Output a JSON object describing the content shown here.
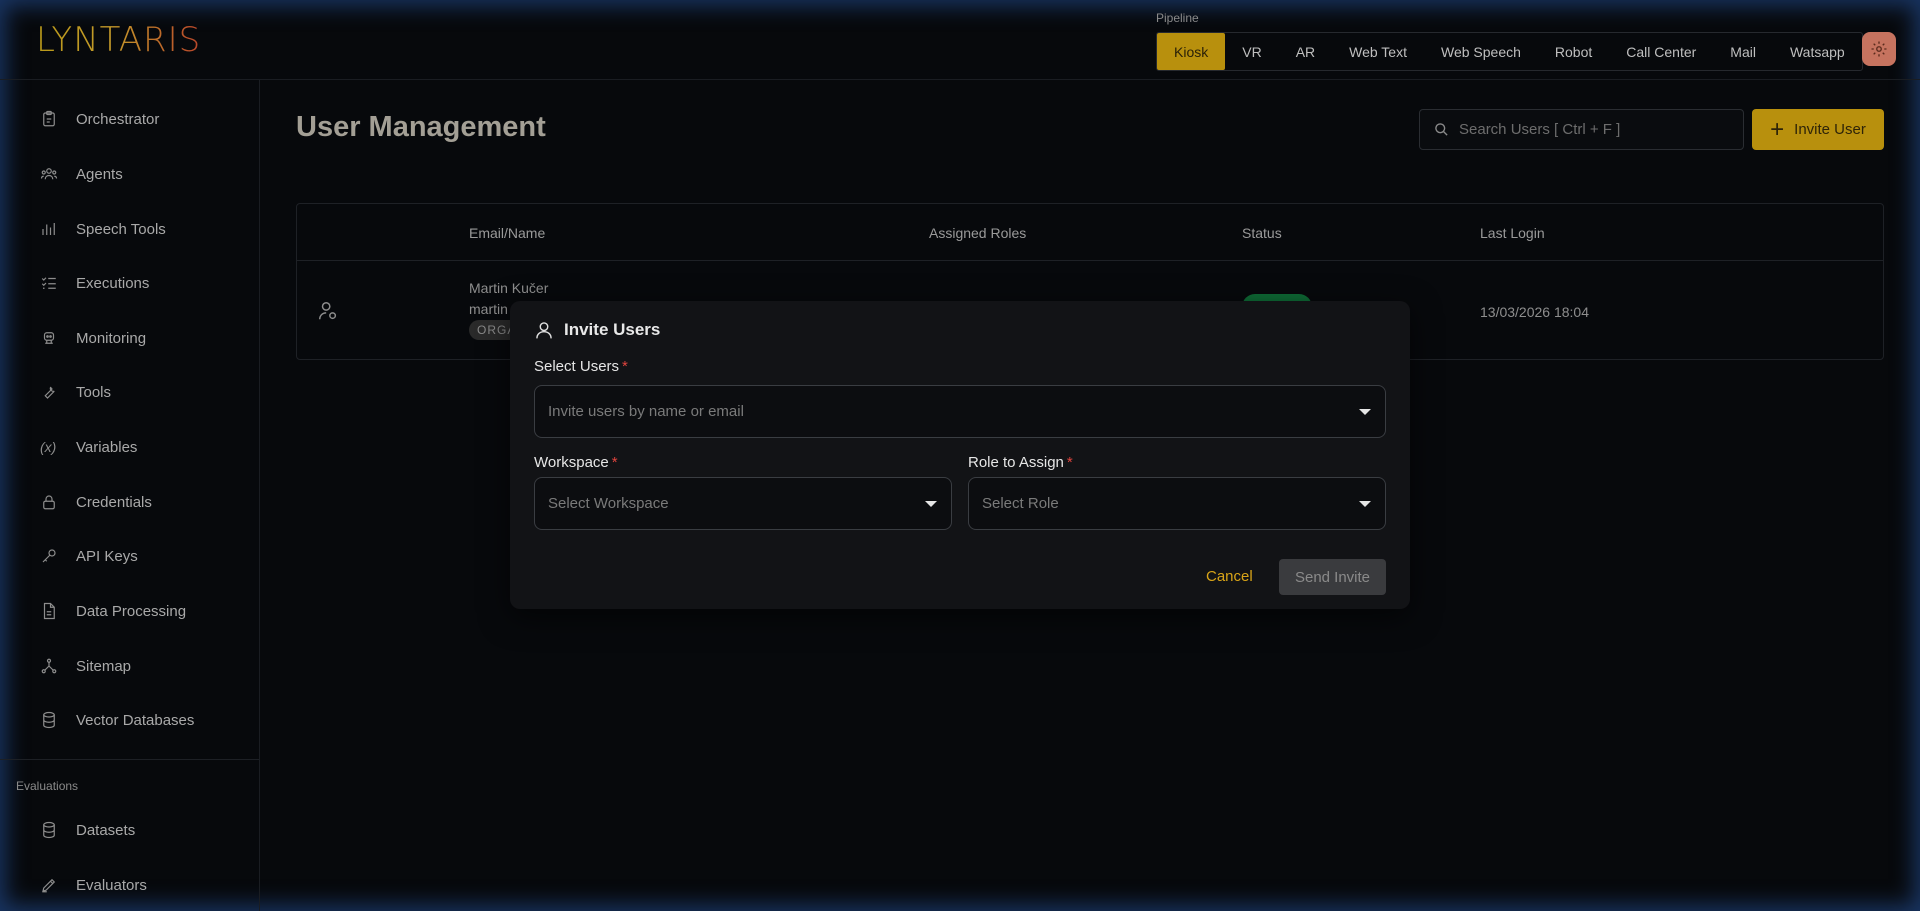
{
  "brand": {
    "logo_text": "LYNTARIS"
  },
  "pipeline": {
    "label": "Pipeline",
    "tabs": [
      "Kiosk",
      "VR",
      "AR",
      "Web Text",
      "Web Speech",
      "Robot",
      "Call Center",
      "Mail",
      "Watsapp"
    ],
    "active": "Kiosk"
  },
  "sidebar": {
    "items": [
      {
        "label": "Orchestrator",
        "icon": "clipboard-icon"
      },
      {
        "label": "Agents",
        "icon": "users-icon"
      },
      {
        "label": "Speech Tools",
        "icon": "bar-chart-icon"
      },
      {
        "label": "Executions",
        "icon": "checklist-icon"
      },
      {
        "label": "Monitoring",
        "icon": "robot-icon"
      },
      {
        "label": "Tools",
        "icon": "wrench-icon"
      },
      {
        "label": "Variables",
        "icon": "variable-icon"
      },
      {
        "label": "Credentials",
        "icon": "lock-icon"
      },
      {
        "label": "API Keys",
        "icon": "key-icon"
      },
      {
        "label": "Data Processing",
        "icon": "file-icon"
      },
      {
        "label": "Sitemap",
        "icon": "network-icon"
      },
      {
        "label": "Vector Databases",
        "icon": "database-icon"
      }
    ],
    "section_label": "Evaluations",
    "eval_items": [
      {
        "label": "Datasets",
        "icon": "database-icon"
      },
      {
        "label": "Evaluators",
        "icon": "pen-icon"
      }
    ]
  },
  "main": {
    "title": "User Management",
    "search_placeholder": "Search Users [ Ctrl + F ]",
    "invite_button": "Invite User",
    "table": {
      "headers": [
        "Email/Name",
        "Assigned Roles",
        "Status",
        "Last Login"
      ],
      "rows": [
        {
          "name": "Martin Kučer",
          "email": "martin",
          "badge": "ORGA",
          "last_login": "13/03/2026 18:04"
        }
      ]
    }
  },
  "modal": {
    "title": "Invite Users",
    "select_users_label": "Select Users",
    "select_users_placeholder": "Invite users by name or email",
    "workspace_label": "Workspace",
    "workspace_placeholder": "Select Workspace",
    "role_label": "Role to Assign",
    "role_placeholder": "Select Role",
    "required_mark": "*",
    "cancel": "Cancel",
    "send": "Send Invite"
  },
  "colors": {
    "accent": "#b8900d",
    "background": "#07090c",
    "modal_bg": "#121316",
    "status_active": "#0e6a35",
    "required": "#e0443e"
  }
}
